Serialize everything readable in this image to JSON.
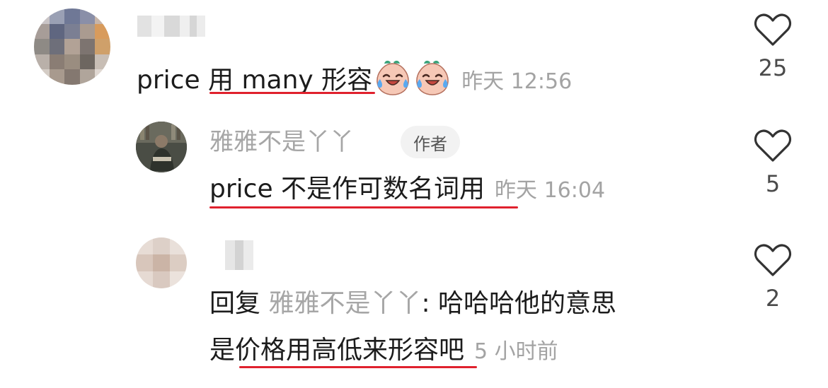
{
  "comments": [
    {
      "text_a": "price ",
      "text_b": "用 many 形容",
      "time": "昨天 12:56",
      "likes": "25",
      "emoji_name": "laugh-cry-peach-emoji"
    },
    {
      "username": "雅雅不是丫丫",
      "badge": "作者",
      "text": "price 不是作可数名词用",
      "time": "昨天 16:04",
      "likes": "5"
    },
    {
      "reply_prefix": "回复 ",
      "reply_to": "雅雅不是丫丫",
      "line1_rest": ": 哈哈哈他的意思",
      "line2_a": "是",
      "line2_b": "价格用高低来形容",
      "line2_c": "吧",
      "time": "5 小时前",
      "likes": "2"
    }
  ],
  "colors": {
    "underline": "#e0212d",
    "meta_gray": "#a3a3a3",
    "badge_bg": "#f2f2f2"
  },
  "icons": {
    "like": "heart-outline-icon"
  }
}
